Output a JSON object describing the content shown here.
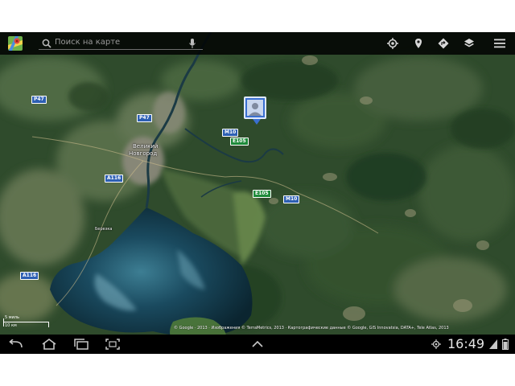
{
  "toolbar": {
    "search_placeholder": "Поиск на карте",
    "icons": [
      "maps-logo-icon",
      "search-icon",
      "microphone-icon",
      "my-location-icon",
      "places-icon",
      "directions-icon",
      "layers-icon",
      "menu-icon"
    ]
  },
  "map": {
    "city_label": [
      "Великий",
      "Новгород"
    ],
    "small_place": "Березка",
    "roads": {
      "p47_top": "P47",
      "p47_city": "P47",
      "a116_upper": "A116",
      "a116_lower": "A116",
      "m10_upper": "M10",
      "m10_lower": "M10",
      "e105_upper": "E105",
      "e105_lower": "E105"
    },
    "scale": {
      "top": "5 миль",
      "bottom": "10 км"
    },
    "copyright": "© Google · 2013 · Изображения © TerraMetrics, 2013 · Картографические данные © Google, GIS Innovatsia, DATA+, Tele Atlas, 2013"
  },
  "system_bar": {
    "time": "16:49",
    "icons": [
      "back-icon",
      "home-icon",
      "recent-apps-icon",
      "screenshot-icon",
      "up-chevron-icon",
      "gps-icon",
      "signal-icon",
      "battery-icon"
    ]
  },
  "colors": {
    "toolbar": "#1a1a1a",
    "lake": "#12384a",
    "forest": "#2d4a2a",
    "marker": "#3a6fd0"
  }
}
